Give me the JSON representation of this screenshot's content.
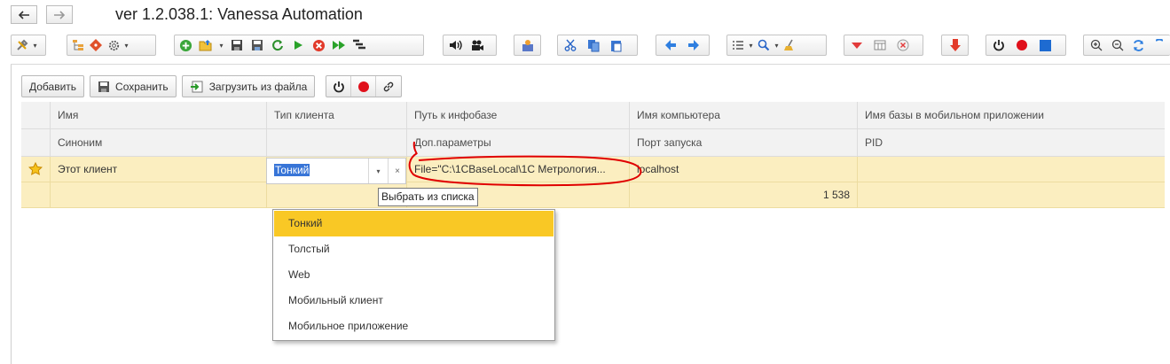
{
  "window": {
    "title": "ver 1.2.038.1: Vanessa Automation",
    "back_icon": "arrow-left-icon",
    "forward_icon": "arrow-right-icon"
  },
  "toolbar_icons": [
    "tools-icon",
    "tree-icon",
    "git-icon",
    "gear-icon",
    "add-circle-icon",
    "open-folder-icon",
    "save-icon",
    "save-all-icon",
    "refresh-icon",
    "play-icon",
    "stop-icon",
    "fast-forward-icon",
    "step-icon",
    "speaker-icon",
    "camera-icon",
    "user-report-icon",
    "cut-icon",
    "copy-icon",
    "paste-icon",
    "arrow-left-blue-icon",
    "arrow-right-blue-icon",
    "list-icon",
    "search-icon",
    "broom-icon",
    "collapse-icon",
    "table-icon",
    "close-circle-icon",
    "arrow-down-red-icon",
    "power-icon",
    "record-icon",
    "stop-square-icon",
    "zoom-in-icon",
    "zoom-out-icon",
    "sync-icon"
  ],
  "commands": {
    "add_label": "Добавить",
    "save_label": "Сохранить",
    "load_label": "Загрузить из файла"
  },
  "grid": {
    "headers_row1": [
      "Имя",
      "Тип клиента",
      "Путь к инфобазе",
      "Имя компьютера",
      "Имя базы в мобильном приложении"
    ],
    "headers_row2": [
      "Синоним",
      "",
      "Доп.параметры",
      "Порт запуска",
      "PID"
    ],
    "row": {
      "name": "Этот клиент",
      "client_type": "Тонкий",
      "path": "File=\"C:\\1CBaseLocal\\1C Метрология...",
      "computer": "localhost",
      "port": "1 538"
    }
  },
  "tooltip": "Выбрать из списка",
  "dropdown": {
    "options": [
      "Тонкий",
      "Толстый",
      "Web",
      "Мобильный клиент",
      "Мобильное приложение"
    ],
    "selected": "Тонкий"
  },
  "colors": {
    "row_highlight": "#fbeec0",
    "selected_option": "#f9c825",
    "annotation_red": "#e00000"
  }
}
